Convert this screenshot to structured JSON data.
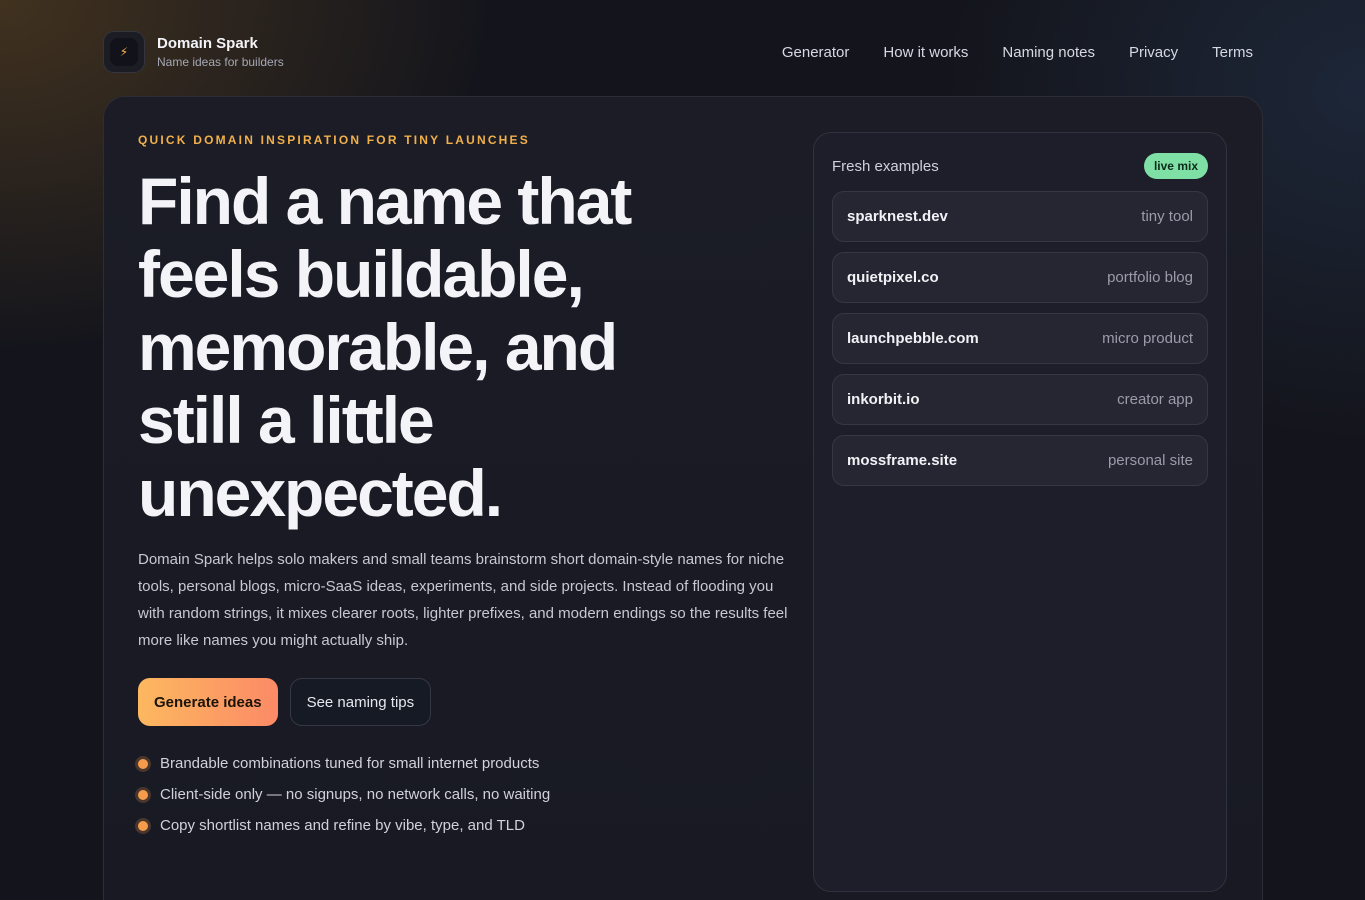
{
  "brand": {
    "name": "Domain Spark",
    "tagline": "Name ideas for builders",
    "logo_icon": "⚡"
  },
  "nav": [
    {
      "label": "Generator"
    },
    {
      "label": "How it works"
    },
    {
      "label": "Naming notes"
    },
    {
      "label": "Privacy"
    },
    {
      "label": "Terms"
    }
  ],
  "hero": {
    "eyebrow": "QUICK DOMAIN INSPIRATION FOR TINY LAUNCHES",
    "headline": "Find a name that feels buildable, memorable, and still a little unexpected.",
    "description": "Domain Spark helps solo makers and small teams brainstorm short domain-style names for niche tools, personal blogs, micro-SaaS ideas, experiments, and side projects. Instead of flooding you with random strings, it mixes clearer roots, lighter prefixes, and modern endings so the results feel more like names you might actually ship.",
    "primary_button": "Generate ideas",
    "secondary_button": "See naming tips",
    "features": [
      "Brandable combinations tuned for small internet products",
      "Client-side only — no signups, no network calls, no waiting",
      "Copy shortlist names and refine by vibe, type, and TLD"
    ]
  },
  "examples": {
    "title": "Fresh examples",
    "badge": "live mix",
    "items": [
      {
        "domain": "sparknest.dev",
        "tag": "tiny tool"
      },
      {
        "domain": "quietpixel.co",
        "tag": "portfolio blog"
      },
      {
        "domain": "launchpebble.com",
        "tag": "micro product"
      },
      {
        "domain": "inkorbit.io",
        "tag": "creator app"
      },
      {
        "domain": "mossframe.site",
        "tag": "personal site"
      }
    ]
  },
  "colors": {
    "accent": "#f2b04a",
    "button_gradient_start": "#fcb860",
    "button_gradient_end": "#fc8a66",
    "badge": "#7fe0a6",
    "bullet": "#f59c4c"
  }
}
